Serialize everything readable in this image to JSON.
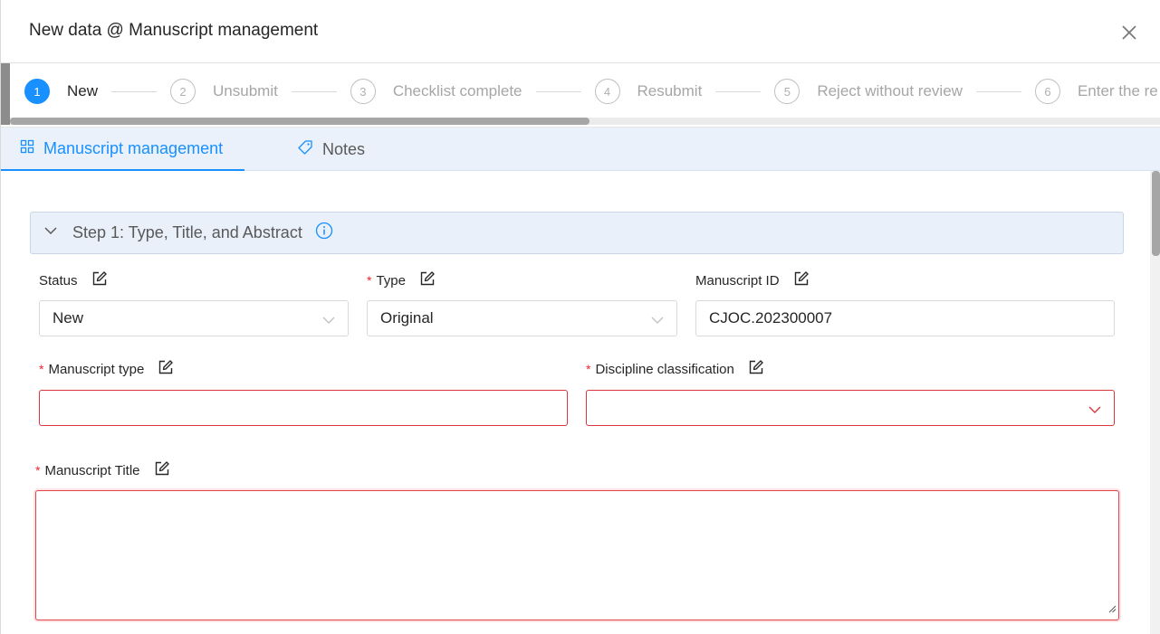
{
  "header": {
    "title": "New data @ Manuscript management"
  },
  "steps": [
    {
      "number": "1",
      "label": "New",
      "active": true
    },
    {
      "number": "2",
      "label": "Unsubmit",
      "active": false
    },
    {
      "number": "3",
      "label": "Checklist complete",
      "active": false
    },
    {
      "number": "4",
      "label": "Resubmit",
      "active": false
    },
    {
      "number": "5",
      "label": "Reject without review",
      "active": false
    },
    {
      "number": "6",
      "label": "Enter the re",
      "active": false
    }
  ],
  "tabs": [
    {
      "label": "Manuscript management",
      "icon": "grid-icon",
      "active": true
    },
    {
      "label": "Notes",
      "icon": "tag-icon",
      "active": false
    }
  ],
  "section": {
    "title": "Step 1: Type, Title, and Abstract"
  },
  "fields": {
    "status": {
      "label": "Status",
      "value": "New",
      "required": false
    },
    "type": {
      "label": "Type",
      "value": "Original",
      "required": true
    },
    "manuscript_id": {
      "label": "Manuscript ID",
      "value": "CJOC.202300007",
      "required": false
    },
    "manuscript_type": {
      "label": "Manuscript type",
      "value": "",
      "required": true
    },
    "discipline": {
      "label": "Discipline classification",
      "value": "",
      "required": true
    },
    "title": {
      "label": "Manuscript Title",
      "value": "",
      "required": true
    }
  },
  "required_marker": "*",
  "colors": {
    "accent": "#1890ff",
    "error": "#f5222d",
    "tab_bar": "#eaf1fa"
  }
}
